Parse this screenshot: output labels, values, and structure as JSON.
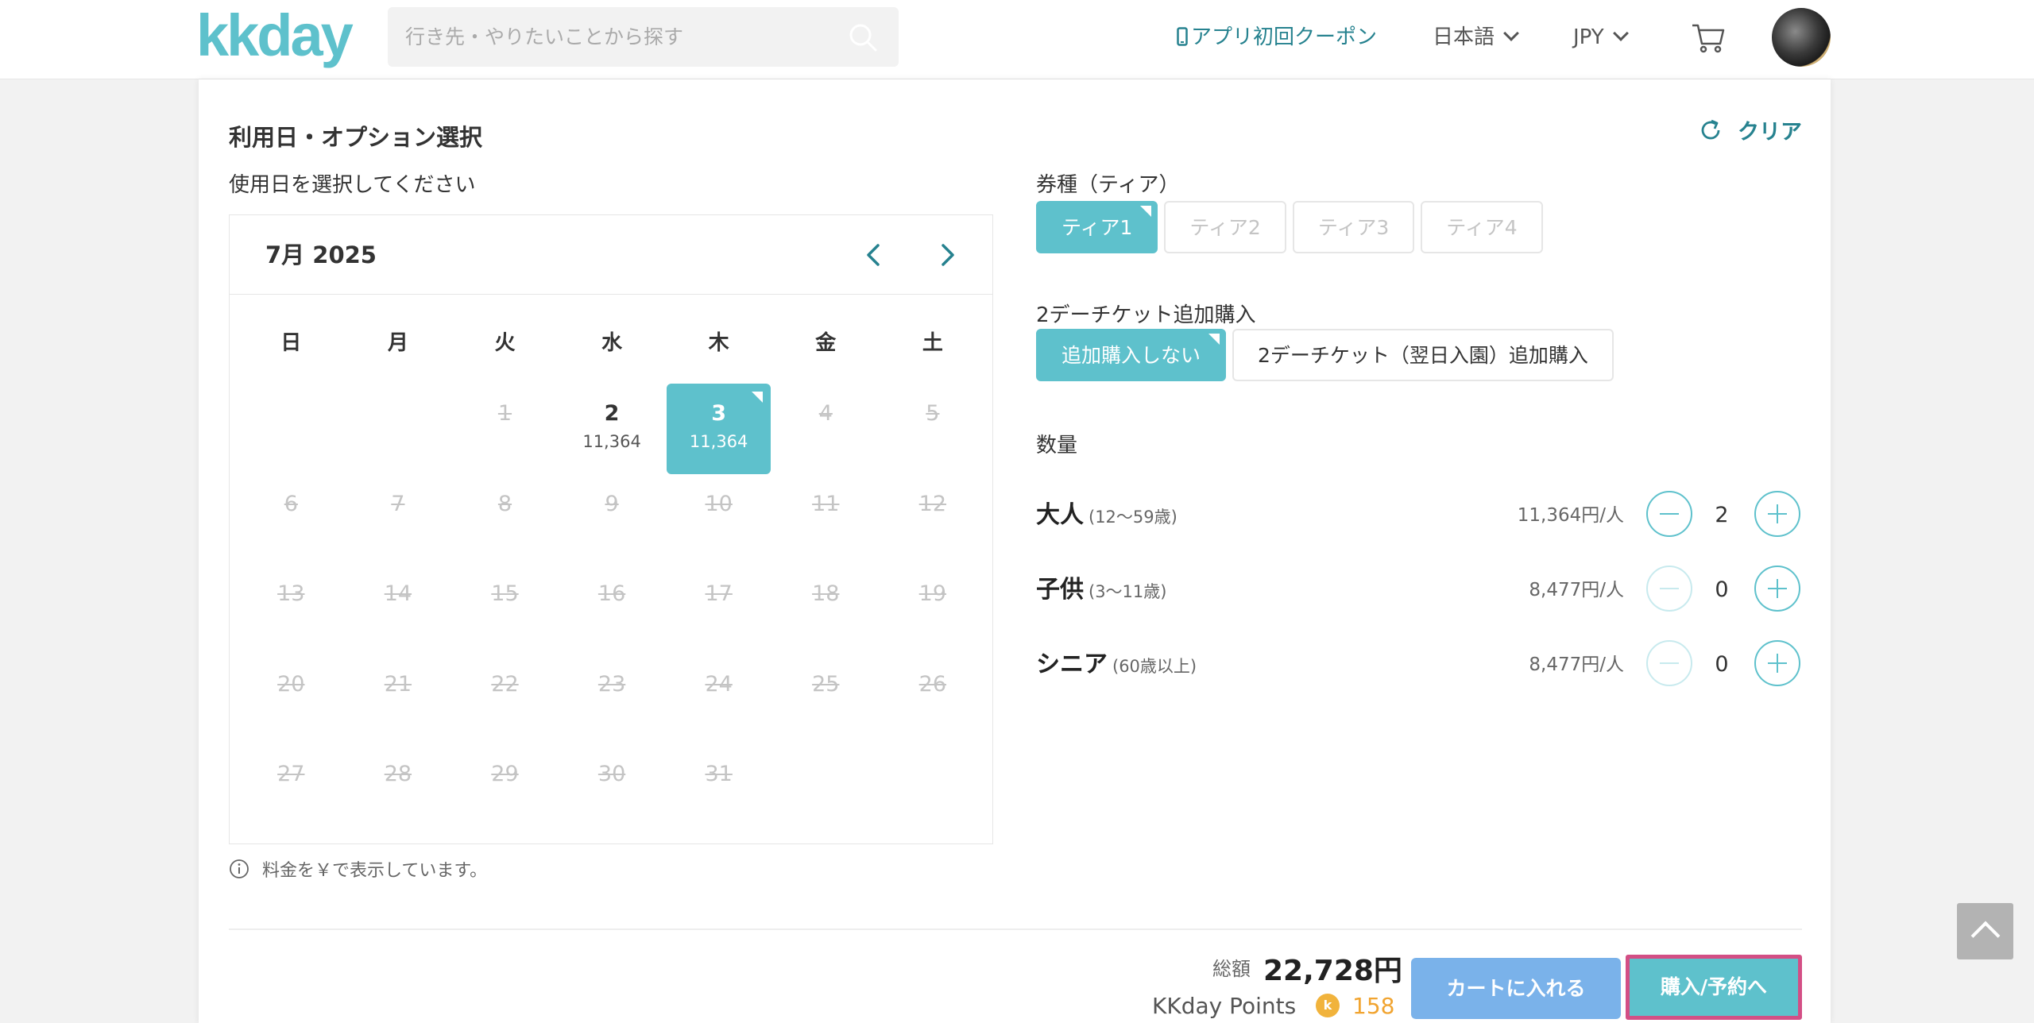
{
  "header": {
    "logo": "kkday",
    "search_placeholder": "行き先・やりたいことから探す",
    "coupon": "アプリ初回クーポン",
    "language": "日本語",
    "currency": "JPY"
  },
  "panel": {
    "title": "利用日・オプション選択",
    "clear": "クリア",
    "date_label": "使用日を選択してください",
    "note": "料金を￥で表示しています。"
  },
  "calendar": {
    "month": "7月 2025",
    "weekdays": [
      "日",
      "月",
      "火",
      "水",
      "木",
      "金",
      "土"
    ],
    "days": [
      {
        "num": "",
        "price": "",
        "state": "empty"
      },
      {
        "num": "",
        "price": "",
        "state": "empty"
      },
      {
        "num": "1",
        "price": "",
        "state": "disabled"
      },
      {
        "num": "2",
        "price": "11,364",
        "state": "available"
      },
      {
        "num": "3",
        "price": "11,364",
        "state": "selected"
      },
      {
        "num": "4",
        "price": "",
        "state": "disabled"
      },
      {
        "num": "5",
        "price": "",
        "state": "disabled"
      },
      {
        "num": "6",
        "price": "",
        "state": "disabled"
      },
      {
        "num": "7",
        "price": "",
        "state": "disabled"
      },
      {
        "num": "8",
        "price": "",
        "state": "disabled"
      },
      {
        "num": "9",
        "price": "",
        "state": "disabled"
      },
      {
        "num": "10",
        "price": "",
        "state": "disabled"
      },
      {
        "num": "11",
        "price": "",
        "state": "disabled"
      },
      {
        "num": "12",
        "price": "",
        "state": "disabled"
      },
      {
        "num": "13",
        "price": "",
        "state": "disabled"
      },
      {
        "num": "14",
        "price": "",
        "state": "disabled"
      },
      {
        "num": "15",
        "price": "",
        "state": "disabled"
      },
      {
        "num": "16",
        "price": "",
        "state": "disabled"
      },
      {
        "num": "17",
        "price": "",
        "state": "disabled"
      },
      {
        "num": "18",
        "price": "",
        "state": "disabled"
      },
      {
        "num": "19",
        "price": "",
        "state": "disabled"
      },
      {
        "num": "20",
        "price": "",
        "state": "disabled"
      },
      {
        "num": "21",
        "price": "",
        "state": "disabled"
      },
      {
        "num": "22",
        "price": "",
        "state": "disabled"
      },
      {
        "num": "23",
        "price": "",
        "state": "disabled"
      },
      {
        "num": "24",
        "price": "",
        "state": "disabled"
      },
      {
        "num": "25",
        "price": "",
        "state": "disabled"
      },
      {
        "num": "26",
        "price": "",
        "state": "disabled"
      },
      {
        "num": "27",
        "price": "",
        "state": "disabled"
      },
      {
        "num": "28",
        "price": "",
        "state": "disabled"
      },
      {
        "num": "29",
        "price": "",
        "state": "disabled"
      },
      {
        "num": "30",
        "price": "",
        "state": "disabled"
      },
      {
        "num": "31",
        "price": "",
        "state": "disabled"
      }
    ]
  },
  "tiers": {
    "label": "券種（ティア）",
    "options": [
      {
        "label": "ティア1",
        "state": "active"
      },
      {
        "label": "ティア2",
        "state": "disabled"
      },
      {
        "label": "ティア3",
        "state": "disabled"
      },
      {
        "label": "ティア4",
        "state": "disabled"
      }
    ]
  },
  "addons": {
    "label": "2デーチケット追加購入",
    "options": [
      {
        "label": "追加購入しない",
        "state": "active"
      },
      {
        "label": "2デーチケット（翌日入園）追加購入",
        "state": "normal"
      }
    ]
  },
  "quantity": {
    "label": "数量",
    "rows": [
      {
        "name": "大人",
        "age": "(12〜59歳)",
        "price": "11,364円/人",
        "count": "2",
        "minus_enabled": true
      },
      {
        "name": "子供",
        "age": "(3〜11歳)",
        "price": "8,477円/人",
        "count": "0",
        "minus_enabled": false
      },
      {
        "name": "シニア",
        "age": "(60歳以上)",
        "price": "8,477円/人",
        "count": "0",
        "minus_enabled": false
      }
    ]
  },
  "footer": {
    "total_label": "総額",
    "total_value": "22,728円",
    "points_label": "KKday Points",
    "points_value": "158",
    "cart_button": "カートに入れる",
    "buy_button": "購入/予約へ"
  },
  "colors": {
    "accent": "#5ec1cc",
    "accent_dark": "#26828f",
    "cart_blue": "#7ab2ea",
    "highlight_border": "#d34f85",
    "points": "#f1a430"
  }
}
